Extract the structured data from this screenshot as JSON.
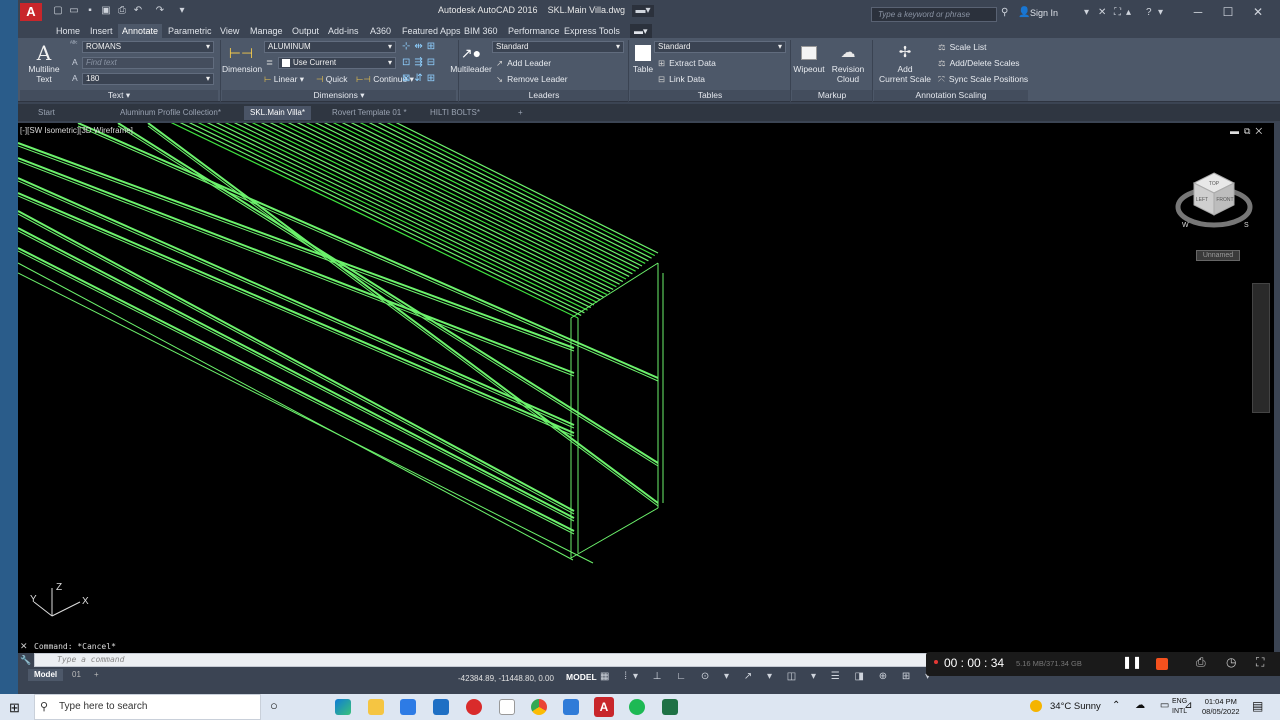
{
  "titlebar": {
    "app_name": "Autodesk AutoCAD 2016",
    "file_name": "SKL.Main Villa.dwg",
    "search_placeholder": "Type a keyword or phrase",
    "sign_in": "Sign In"
  },
  "menu_tabs": [
    "Home",
    "Insert",
    "Annotate",
    "Parametric",
    "View",
    "Manage",
    "Output",
    "Add-ins",
    "A360",
    "Featured Apps",
    "BIM 360",
    "Performance",
    "Express Tools"
  ],
  "active_menu_tab": "Annotate",
  "ribbon": {
    "text_panel": {
      "multiline_label_1": "Multiline",
      "multiline_label_2": "Text",
      "font_combo": "ROMANS",
      "find_placeholder": "Find text",
      "height_combo": "180",
      "panel_label": "Text"
    },
    "dimensions_panel": {
      "dimension_label": "Dimension",
      "style_combo": "ALUMINUM",
      "layer_combo": "Use Current",
      "linear": "Linear",
      "quick": "Quick",
      "continue": "Continue",
      "panel_label": "Dimensions"
    },
    "leaders_panel": {
      "multileader_label": "Multileader",
      "style_combo": "Standard",
      "add_leader": "Add Leader",
      "remove_leader": "Remove Leader",
      "panel_label": "Leaders"
    },
    "tables_panel": {
      "table_label": "Table",
      "style_combo": "Standard",
      "extract_data": "Extract Data",
      "link_data": "Link Data",
      "panel_label": "Tables"
    },
    "markup_panel": {
      "wipeout": "Wipeout",
      "revision_1": "Revision",
      "revision_2": "Cloud",
      "panel_label": "Markup"
    },
    "annotation_scaling_panel": {
      "add_1": "Add",
      "add_2": "Current Scale",
      "scale_list": "Scale List",
      "add_delete_scales": "Add/Delete Scales",
      "sync_scale_positions": "Sync Scale Positions",
      "panel_label": "Annotation Scaling"
    }
  },
  "doc_tabs": [
    {
      "label": "Start"
    },
    {
      "label": "Aluminum Profile Collection*"
    },
    {
      "label": "SKL.Main Villa*"
    },
    {
      "label": "Rovert Template 01 *"
    },
    {
      "label": "HILTI BOLTS*"
    }
  ],
  "active_doc_tab": "SKL.Main Villa*",
  "viewport": {
    "label": "[-][SW Isometric][3D Wireframe]",
    "unnamed_button": "Unnamed",
    "viewcube": {
      "top": "TOP",
      "left": "LEFT",
      "front": "FRONT",
      "w": "W",
      "s": "S"
    },
    "ucs": {
      "x": "X",
      "y": "Y",
      "z": "Z"
    }
  },
  "command_line": {
    "history": "Command: *Cancel*",
    "placeholder": "Type a command"
  },
  "status_bar": {
    "model_tab": "Model",
    "layout_tab": "01",
    "coordinates": "-42384.89, -11448.80, 0.00",
    "model_label": "MODEL"
  },
  "recorder": {
    "time": "00 : 00 : 34",
    "size": "5.16 MB/371.34 GB"
  },
  "taskbar": {
    "search_placeholder": "Type here to search",
    "weather": "34°C  Sunny",
    "lang_1": "ENG",
    "lang_2": "INTL",
    "time": "01:04 PM",
    "date": "08/05/2022"
  },
  "colors": {
    "wireframe": "#6cf26c",
    "accent": "#c8262b"
  }
}
